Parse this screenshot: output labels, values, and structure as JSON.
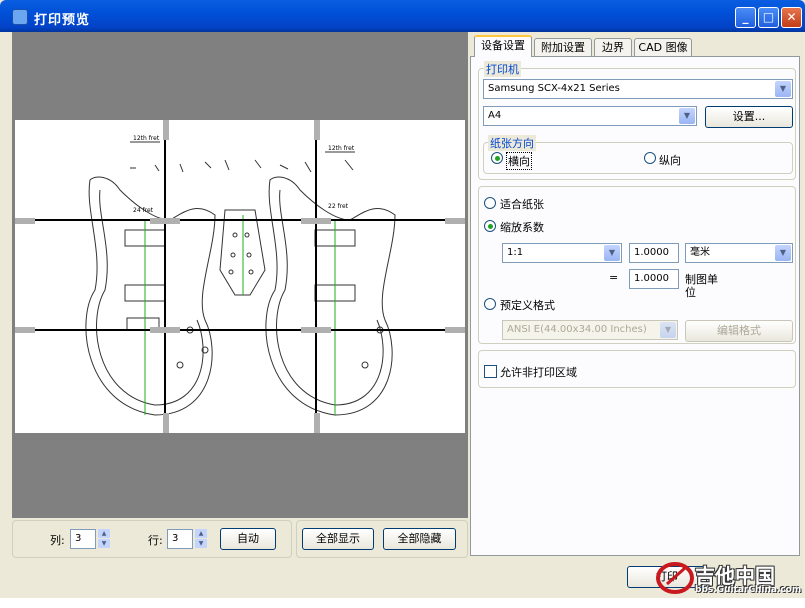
{
  "window": {
    "title": "打印预览"
  },
  "tabs": [
    {
      "label": "设备设置"
    },
    {
      "label": "附加设置"
    },
    {
      "label": "边界"
    },
    {
      "label": "CAD 图像"
    }
  ],
  "printer": {
    "group_label": "打印机",
    "name": "Samsung SCX-4x21 Series",
    "paper": "A4",
    "setup_button": "设置..."
  },
  "orientation": {
    "group_label": "纸张方向",
    "landscape": "横向",
    "portrait": "纵向",
    "selected": "landscape"
  },
  "scaling": {
    "fit_label": "适合纸张",
    "scale_label": "缩放系数",
    "ratio": "1:1",
    "value1": "1.0000",
    "unit": "毫米",
    "equals": "=",
    "value2": "1.0000",
    "drawing_unit": "制图单位",
    "preset_label": "预定义格式",
    "preset_value": "ANSI E(44.00x34.00 Inches)",
    "edit_button": "编辑格式"
  },
  "nonprint": {
    "label": "允许非打印区域",
    "checked": false
  },
  "bottom": {
    "cols_label": "列:",
    "cols": "3",
    "rows_label": "行:",
    "rows": "3",
    "auto_button": "自动",
    "show_all": "全部显示",
    "hide_all": "全部隐藏"
  },
  "footer": {
    "print_button": "打印"
  },
  "drawing": {
    "fret_labels": [
      "12th fret",
      "12th fret",
      "24 fret",
      "22 fret"
    ]
  },
  "watermark": {
    "brand": "吉他中国",
    "url": "bbs.GuitarChina.com"
  }
}
